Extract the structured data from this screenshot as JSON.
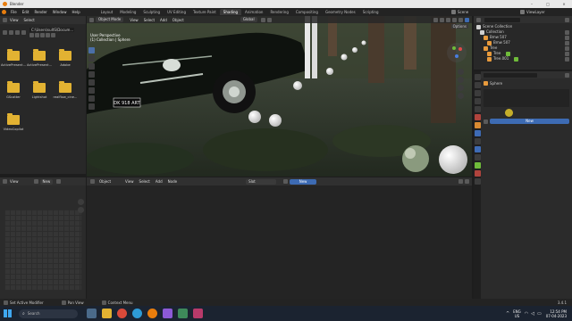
{
  "title_bar": {
    "app_name": "Blender"
  },
  "menu": {
    "items": [
      "File",
      "Edit",
      "Render",
      "Window",
      "Help"
    ],
    "workspaces": [
      "Layout",
      "Modeling",
      "Sculpting",
      "UV Editing",
      "Texture Paint",
      "Shading",
      "Animation",
      "Rendering",
      "Compositing",
      "Geometry Nodes",
      "Scripting"
    ],
    "active_workspace": "Shading",
    "scene": "Scene",
    "view_layer": "ViewLayer"
  },
  "file_browser": {
    "view_label": "View",
    "select_label": "Select",
    "path": "C:\\Users\\sultS\\Docum...",
    "folders": [
      "ActivePresent...",
      "ActivePresent...",
      "Adobe",
      "GScatter",
      "Lightshot",
      "realflow_cine...",
      "VideoCopilot"
    ]
  },
  "viewport": {
    "mode": "Object Mode",
    "menus": [
      "View",
      "Select",
      "Add",
      "Object"
    ],
    "transform": "Global",
    "overlay_line1": "User Perspective",
    "overlay_line2": "(1) Collection | Sphere",
    "options_label": "Options"
  },
  "node_editor": {
    "type_label": "Object",
    "menus": [
      "View",
      "Select",
      "Add",
      "Node"
    ],
    "slot": "Slot",
    "new_label": "New"
  },
  "image_editor": {
    "view_label": "View",
    "new_label": "New"
  },
  "outliner": {
    "title": "Scene Collection",
    "items": [
      {
        "name": "Collection",
        "indent": 0
      },
      {
        "name": "Bmw 507",
        "indent": 1
      },
      {
        "name": "Bmw 507",
        "indent": 2
      },
      {
        "name": "Tree",
        "indent": 1
      },
      {
        "name": "Tree",
        "indent": 2
      },
      {
        "name": "Tree.001",
        "indent": 2
      }
    ]
  },
  "properties": {
    "object_name": "Sphere",
    "new_label": "New"
  },
  "status_bar": {
    "items": [
      "Set Active Modifier",
      "Pan View",
      "Context Menu"
    ],
    "version": "3.4.1"
  },
  "taskbar": {
    "search_placeholder": "Search",
    "lang1": "ENG",
    "lang2": "US",
    "time": "12:54 PM",
    "date": "07-04-2023"
  },
  "colors": {
    "accent": "#3d6bb3",
    "folder": "#e2b232",
    "panel": "#303030"
  }
}
